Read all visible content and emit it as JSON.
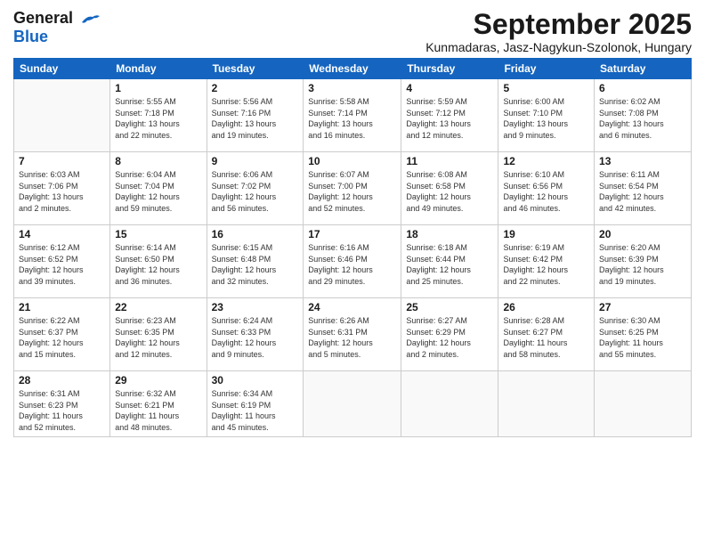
{
  "header": {
    "logo_line1": "General",
    "logo_line2": "Blue",
    "title": "September 2025",
    "subtitle": "Kunmadaras, Jasz-Nagykun-Szolonok, Hungary"
  },
  "weekdays": [
    "Sunday",
    "Monday",
    "Tuesday",
    "Wednesday",
    "Thursday",
    "Friday",
    "Saturday"
  ],
  "weeks": [
    [
      {
        "day": "",
        "info": ""
      },
      {
        "day": "1",
        "info": "Sunrise: 5:55 AM\nSunset: 7:18 PM\nDaylight: 13 hours\nand 22 minutes."
      },
      {
        "day": "2",
        "info": "Sunrise: 5:56 AM\nSunset: 7:16 PM\nDaylight: 13 hours\nand 19 minutes."
      },
      {
        "day": "3",
        "info": "Sunrise: 5:58 AM\nSunset: 7:14 PM\nDaylight: 13 hours\nand 16 minutes."
      },
      {
        "day": "4",
        "info": "Sunrise: 5:59 AM\nSunset: 7:12 PM\nDaylight: 13 hours\nand 12 minutes."
      },
      {
        "day": "5",
        "info": "Sunrise: 6:00 AM\nSunset: 7:10 PM\nDaylight: 13 hours\nand 9 minutes."
      },
      {
        "day": "6",
        "info": "Sunrise: 6:02 AM\nSunset: 7:08 PM\nDaylight: 13 hours\nand 6 minutes."
      }
    ],
    [
      {
        "day": "7",
        "info": "Sunrise: 6:03 AM\nSunset: 7:06 PM\nDaylight: 13 hours\nand 2 minutes."
      },
      {
        "day": "8",
        "info": "Sunrise: 6:04 AM\nSunset: 7:04 PM\nDaylight: 12 hours\nand 59 minutes."
      },
      {
        "day": "9",
        "info": "Sunrise: 6:06 AM\nSunset: 7:02 PM\nDaylight: 12 hours\nand 56 minutes."
      },
      {
        "day": "10",
        "info": "Sunrise: 6:07 AM\nSunset: 7:00 PM\nDaylight: 12 hours\nand 52 minutes."
      },
      {
        "day": "11",
        "info": "Sunrise: 6:08 AM\nSunset: 6:58 PM\nDaylight: 12 hours\nand 49 minutes."
      },
      {
        "day": "12",
        "info": "Sunrise: 6:10 AM\nSunset: 6:56 PM\nDaylight: 12 hours\nand 46 minutes."
      },
      {
        "day": "13",
        "info": "Sunrise: 6:11 AM\nSunset: 6:54 PM\nDaylight: 12 hours\nand 42 minutes."
      }
    ],
    [
      {
        "day": "14",
        "info": "Sunrise: 6:12 AM\nSunset: 6:52 PM\nDaylight: 12 hours\nand 39 minutes."
      },
      {
        "day": "15",
        "info": "Sunrise: 6:14 AM\nSunset: 6:50 PM\nDaylight: 12 hours\nand 36 minutes."
      },
      {
        "day": "16",
        "info": "Sunrise: 6:15 AM\nSunset: 6:48 PM\nDaylight: 12 hours\nand 32 minutes."
      },
      {
        "day": "17",
        "info": "Sunrise: 6:16 AM\nSunset: 6:46 PM\nDaylight: 12 hours\nand 29 minutes."
      },
      {
        "day": "18",
        "info": "Sunrise: 6:18 AM\nSunset: 6:44 PM\nDaylight: 12 hours\nand 25 minutes."
      },
      {
        "day": "19",
        "info": "Sunrise: 6:19 AM\nSunset: 6:42 PM\nDaylight: 12 hours\nand 22 minutes."
      },
      {
        "day": "20",
        "info": "Sunrise: 6:20 AM\nSunset: 6:39 PM\nDaylight: 12 hours\nand 19 minutes."
      }
    ],
    [
      {
        "day": "21",
        "info": "Sunrise: 6:22 AM\nSunset: 6:37 PM\nDaylight: 12 hours\nand 15 minutes."
      },
      {
        "day": "22",
        "info": "Sunrise: 6:23 AM\nSunset: 6:35 PM\nDaylight: 12 hours\nand 12 minutes."
      },
      {
        "day": "23",
        "info": "Sunrise: 6:24 AM\nSunset: 6:33 PM\nDaylight: 12 hours\nand 9 minutes."
      },
      {
        "day": "24",
        "info": "Sunrise: 6:26 AM\nSunset: 6:31 PM\nDaylight: 12 hours\nand 5 minutes."
      },
      {
        "day": "25",
        "info": "Sunrise: 6:27 AM\nSunset: 6:29 PM\nDaylight: 12 hours\nand 2 minutes."
      },
      {
        "day": "26",
        "info": "Sunrise: 6:28 AM\nSunset: 6:27 PM\nDaylight: 11 hours\nand 58 minutes."
      },
      {
        "day": "27",
        "info": "Sunrise: 6:30 AM\nSunset: 6:25 PM\nDaylight: 11 hours\nand 55 minutes."
      }
    ],
    [
      {
        "day": "28",
        "info": "Sunrise: 6:31 AM\nSunset: 6:23 PM\nDaylight: 11 hours\nand 52 minutes."
      },
      {
        "day": "29",
        "info": "Sunrise: 6:32 AM\nSunset: 6:21 PM\nDaylight: 11 hours\nand 48 minutes."
      },
      {
        "day": "30",
        "info": "Sunrise: 6:34 AM\nSunset: 6:19 PM\nDaylight: 11 hours\nand 45 minutes."
      },
      {
        "day": "",
        "info": ""
      },
      {
        "day": "",
        "info": ""
      },
      {
        "day": "",
        "info": ""
      },
      {
        "day": "",
        "info": ""
      }
    ]
  ]
}
